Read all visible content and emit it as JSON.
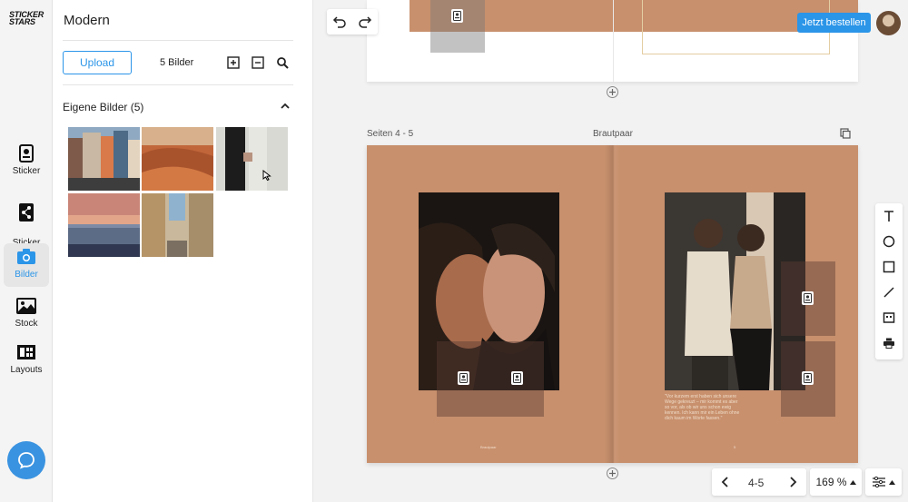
{
  "brand": {
    "logo_line1": "STICKER",
    "logo_line2": "STARS"
  },
  "rail": {
    "items": [
      {
        "label": "Sticker",
        "icon": "sticker-icon"
      },
      {
        "label": "Sticker\nLink",
        "icon": "share-icon"
      },
      {
        "label": "Bilder",
        "icon": "camera-icon",
        "active": true
      },
      {
        "label": "Stock",
        "icon": "image-icon"
      },
      {
        "label": "Layouts",
        "icon": "layout-icon"
      }
    ]
  },
  "panel": {
    "title": "Modern",
    "upload_label": "Upload",
    "image_count": "5 Bilder",
    "section_label": "Eigene Bilder (5)"
  },
  "topbar": {
    "order_label": "Jetzt bestellen"
  },
  "spread": {
    "pages_label": "Seiten 4 - 5",
    "name": "Brautpaar",
    "quote": "\"Vor kurzem erst haben sich unsere Wege gekreuzt – mir kommt es aber so vor, als ob wir uns schon ewig kennen. Ich kann mir ein Leben ohne dich kaum im Worte fassen.\"",
    "folio_left": "Brautpaar",
    "folio_right": "5"
  },
  "pager": {
    "pages": "4-5"
  },
  "zoom": {
    "value": "169 %"
  },
  "colors": {
    "accent": "#2b95e8",
    "page": "#c8906d"
  }
}
